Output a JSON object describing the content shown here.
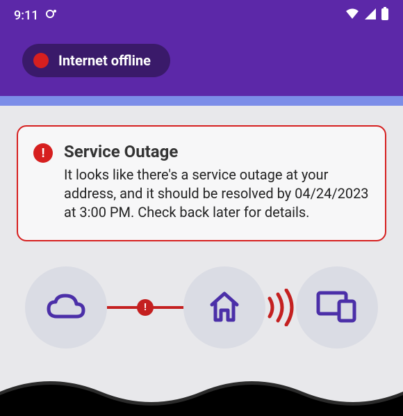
{
  "status_bar": {
    "time": "9:11"
  },
  "header": {
    "status_label": "Internet offline"
  },
  "alert": {
    "title": "Service Outage",
    "body": "It looks like there's a service outage at your address, and it should be resolved by 04/24/2023 at 3:00 PM. Check back later for details."
  }
}
